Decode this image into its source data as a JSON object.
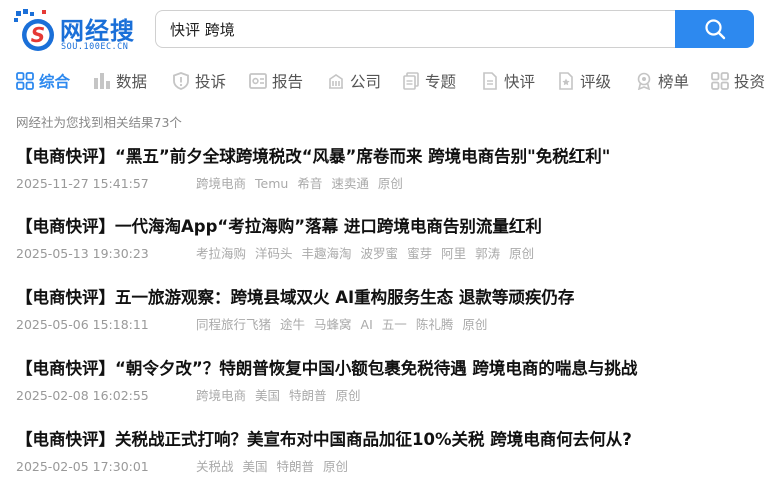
{
  "brand": {
    "name_cn": "网经搜",
    "name_en": "SOU.100EC.CN",
    "color": "#1a6fd8"
  },
  "search": {
    "value": "快评 跨境",
    "accent": "#2d89ef"
  },
  "nav": [
    {
      "label": "综合",
      "icon": "grid-icon",
      "active": true
    },
    {
      "label": "数据",
      "icon": "bar-chart-icon"
    },
    {
      "label": "投诉",
      "icon": "shield-icon"
    },
    {
      "label": "报告",
      "icon": "report-icon"
    },
    {
      "label": "公司",
      "icon": "building-icon"
    },
    {
      "label": "专题",
      "icon": "documents-icon"
    },
    {
      "label": "快评",
      "icon": "document-icon"
    },
    {
      "label": "评级",
      "icon": "rating-icon"
    },
    {
      "label": "榜单",
      "icon": "award-icon"
    },
    {
      "label": "投资",
      "icon": "grid-icon"
    }
  ],
  "result_count": "网经社为您找到相关结果73个",
  "results": [
    {
      "title": "【电商快评】“黑五”前夕全球跨境税改“风暴”席卷而来 跨境电商告别\"免税红利\"",
      "date": "2025-11-27 15:41:57",
      "tags": [
        "跨境电商",
        "Temu",
        "希音",
        "速卖通",
        "原创"
      ]
    },
    {
      "title": "【电商快评】一代海淘App“考拉海购”落幕 进口跨境电商告别流量红利",
      "date": "2025-05-13 19:30:23",
      "tags": [
        "考拉海购",
        "洋码头",
        "丰趣海淘",
        "波罗蜜",
        "蜜芽",
        "阿里",
        "郭涛",
        "原创"
      ]
    },
    {
      "title": "【电商快评】五一旅游观察：跨境县域双火 AI重构服务生态 退款等顽疾仍存",
      "date": "2025-05-06 15:18:11",
      "tags": [
        "同程旅行飞猪",
        "途牛",
        "马蜂窝",
        "AI",
        "五一",
        "陈礼腾",
        "原创"
      ]
    },
    {
      "title": "【电商快评】“朝令夕改”？特朗普恢复中国小额包裹免税待遇 跨境电商的喘息与挑战",
      "date": "2025-02-08 16:02:55",
      "tags": [
        "跨境电商",
        "美国",
        "特朗普",
        "原创"
      ]
    },
    {
      "title": "【电商快评】关税战正式打响？美宣布对中国商品加征10%关税 跨境电商何去何从?",
      "date": "2025-02-05 17:30:01",
      "tags": [
        "关税战",
        "美国",
        "特朗普",
        "原创"
      ]
    }
  ]
}
